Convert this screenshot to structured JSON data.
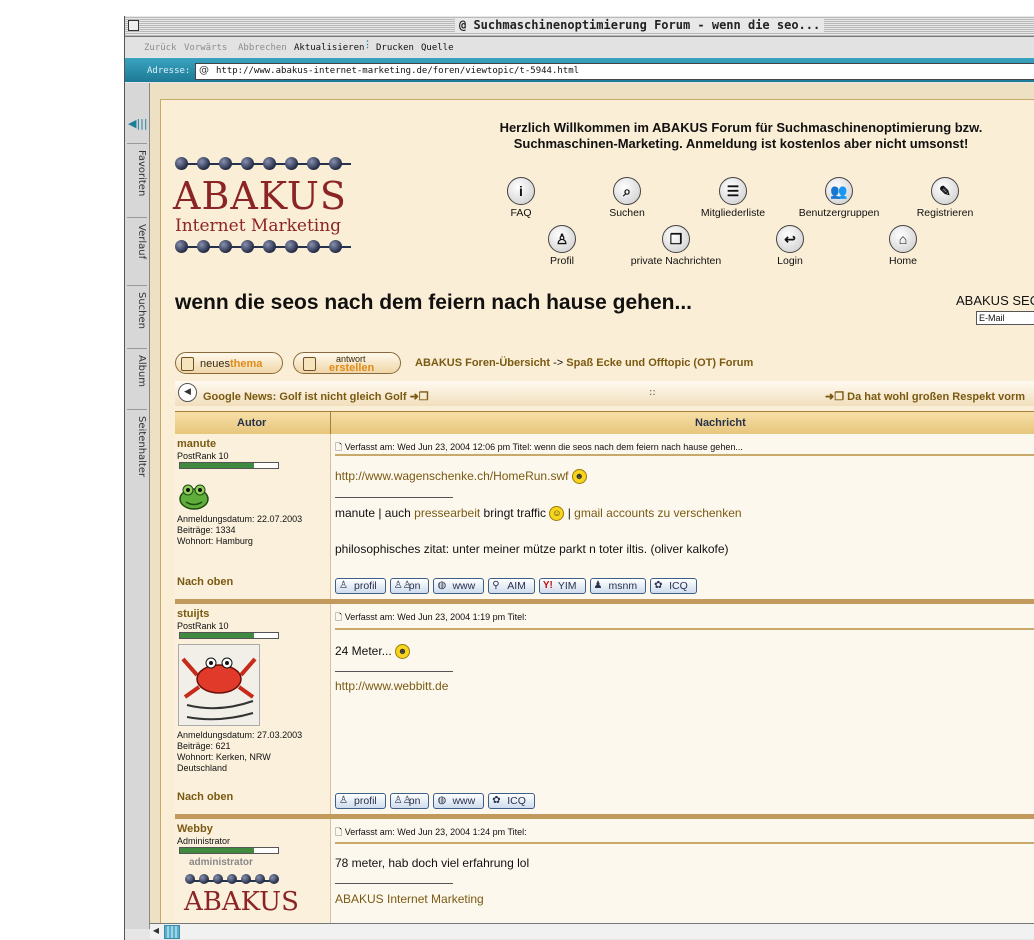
{
  "window": {
    "title": "@ Suchmaschinenoptimierung Forum - wenn die seo..."
  },
  "toolbar": {
    "back": "Zurück",
    "forward": "Vorwärts",
    "stop": "Abbrechen",
    "refresh": "Aktualisieren",
    "print": "Drucken",
    "source": "Quelle"
  },
  "address": {
    "label": "Adresse:",
    "url": "http://www.abakus-internet-marketing.de/foren/viewtopic/t-5944.html"
  },
  "sidebar": {
    "tabs": [
      "Favoriten",
      "Verlauf",
      "Suchen",
      "Album",
      "Seitenhalter"
    ]
  },
  "header": {
    "logo_line1": "ABAKUS",
    "logo_line2": "Internet Marketing",
    "welcome": "Herzlich Willkommen im ABAKUS Forum für Suchmaschinenoptimierung bzw. Suchmaschinen-Marketing. Anmeldung ist kostenlos aber nicht umsonst!",
    "nav": [
      "FAQ",
      "Suchen",
      "Mitgliederliste",
      "Benutzergruppen",
      "Registrieren",
      "Profil",
      "private Nachrichten",
      "Login",
      "Home"
    ]
  },
  "topic": {
    "title": "wenn die seos nach dem feiern nach hause gehen...",
    "seo_label": "ABAKUS SEO",
    "email_placeholder": "E-Mail"
  },
  "actions": {
    "new_topic_a": "neues",
    "new_topic_b": "thema",
    "reply_a": "antwort",
    "reply_b": "erstellen"
  },
  "breadcrumb": {
    "home": "ABAKUS Foren-Übersicht",
    "sep": "->",
    "forum": "Spaß Ecke und Offtopic (OT) Forum"
  },
  "prevnext": {
    "prev": "Google News: Golf ist nicht gleich Golf",
    "mid": "::",
    "next": "Da hat wohl großen Respekt vorm"
  },
  "table": {
    "col_author": "Autor",
    "col_message": "Nachricht"
  },
  "posts": [
    {
      "user": "manute",
      "rank": "PostRank 10",
      "rank_fill": 0.75,
      "joined": "Anmeldungsdatum: 22.07.2003",
      "posts": "Beiträge: 1334",
      "location": "Wohnort: Hamburg",
      "header": "Verfasst am: Wed Jun 23, 2004 12:06 pm    Titel: wenn die seos nach dem feiern nach hause gehen...",
      "line1": "http://www.wagenschenke.ch/HomeRun.swf",
      "sig_a": "manute | auch ",
      "sig_link1": "pressearbeit",
      "sig_b": " bringt traffic ",
      "sig_c": " | ",
      "sig_link2": "gmail accounts zu verschenken",
      "sig2": "philosophisches zitat: unter meiner mütze parkt n toter iltis. (oliver kalkofe)",
      "top": "Nach oben",
      "buttons": [
        "profil",
        "pn",
        "www",
        "AIM",
        "YIM",
        "msnm",
        "ICQ"
      ]
    },
    {
      "user": "stuijts",
      "rank": "PostRank 10",
      "rank_fill": 0.75,
      "joined": "Anmeldungsdatum: 27.03.2003",
      "posts": "Beiträge: 621",
      "location": "Wohnort: Kerken, NRW",
      "location2": "Deutschland",
      "header": "Verfasst am: Wed Jun 23, 2004 1:19 pm    Titel:",
      "line1": "24 Meter...",
      "sig_link": "http://www.webbitt.de",
      "top": "Nach oben",
      "buttons": [
        "profil",
        "pn",
        "www",
        "ICQ"
      ]
    },
    {
      "user": "Webby",
      "rank": "Administrator",
      "rank_label": "administrator",
      "rank_fill": 0.75,
      "header": "Verfasst am: Wed Jun 23, 2004 1:24 pm    Titel:",
      "line1": "78 meter, hab doch viel erfahrung lol",
      "sig_link": "ABAKUS Internet Marketing"
    }
  ],
  "colors": {
    "accent": "#7a5a12",
    "divider": "#c29a5e",
    "page": "#fbeed6",
    "logo": "#8b2525"
  }
}
